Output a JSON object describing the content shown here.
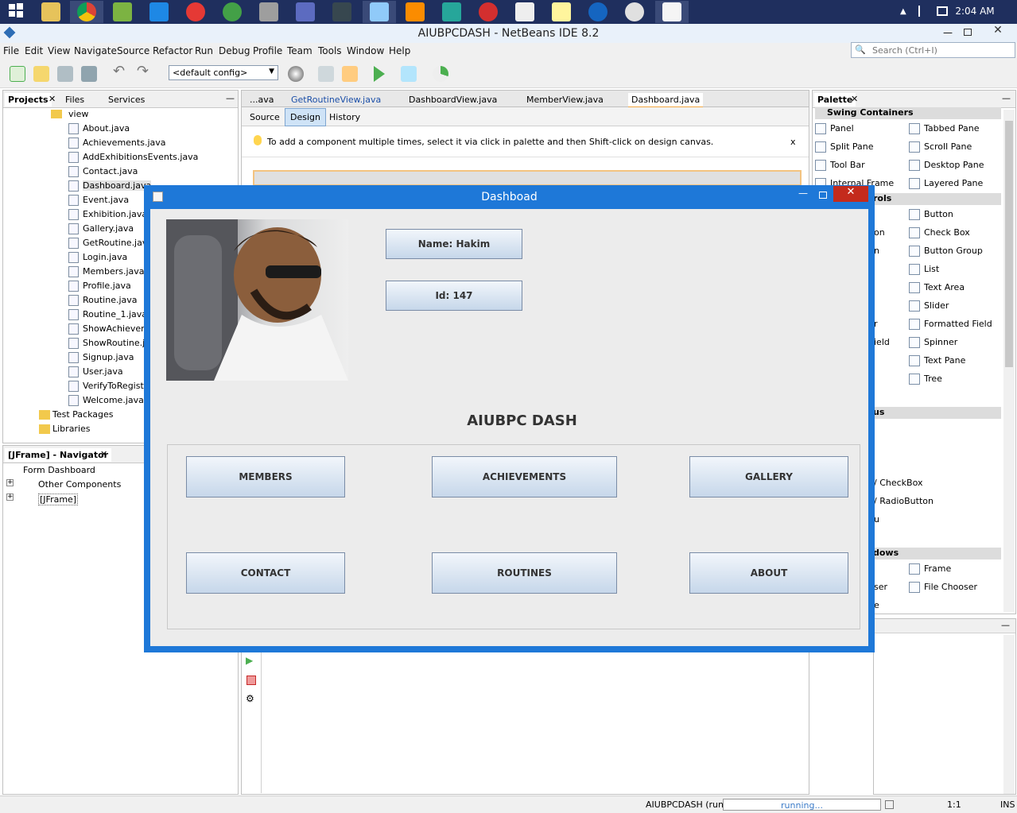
{
  "taskbar": {
    "clock": "2:04 AM"
  },
  "window": {
    "title": "AIUBPCDASH - NetBeans IDE 8.2"
  },
  "menu": [
    "File",
    "Edit",
    "View",
    "Navigate",
    "Source",
    "Refactor",
    "Run",
    "Debug",
    "Profile",
    "Team",
    "Tools",
    "Window",
    "Help"
  ],
  "toolbar": {
    "config": "<default config>"
  },
  "search": {
    "placeholder": "Search (Ctrl+I)"
  },
  "projects_panel": {
    "tabs": [
      "Projects",
      "Files",
      "Services"
    ],
    "folder": "view",
    "files": [
      "About.java",
      "Achievements.java",
      "AddExhibitionsEvents.java",
      "Contact.java",
      "Dashboard.java",
      "Event.java",
      "Exhibition.java",
      "Gallery.java",
      "GetRoutine.java",
      "Login.java",
      "Members.java",
      "Profile.java",
      "Routine.java",
      "Routine_1.java",
      "ShowAchieveme",
      "ShowRoutine.ja",
      "Signup.java",
      "User.java",
      "VerifyToRegiste",
      "Welcome.java"
    ],
    "extra": [
      "Test Packages",
      "Libraries"
    ]
  },
  "navigator": {
    "title": "[JFrame] - Navigator",
    "items": [
      "Form Dashboard",
      "Other Components",
      "[JFrame]"
    ]
  },
  "editor": {
    "tabs": [
      "...ava",
      "GetRoutineView.java",
      "DashboardView.java",
      "MemberView.java",
      "Dashboard.java"
    ],
    "modes": [
      "Source",
      "Design",
      "History"
    ],
    "hint": "To add a component multiple times, select it via click in palette and then Shift-click on design canvas.",
    "hint_close": "x"
  },
  "palette": {
    "title": "Palette",
    "sections": [
      "Swing Containers",
      "rols",
      "us",
      "dows"
    ],
    "left_items": [
      "Panel",
      "Split Pane",
      "Tool Bar",
      "Internal Frame"
    ],
    "right_items": [
      "Tabbed Pane",
      "Scroll Pane",
      "Desktop Pane",
      "Layered Pane"
    ],
    "controls_right": [
      "Button",
      "Check Box",
      "Button Group",
      "List",
      "Text Area",
      "Slider",
      "Formatted Field",
      "Spinner",
      "Text Pane",
      "Tree"
    ],
    "controls_left_fragments": [
      "on",
      "n",
      "r",
      "ield"
    ],
    "menu_fragments": [
      "/ CheckBox",
      "/ RadioButton",
      "u"
    ],
    "windows_right": [
      "Frame",
      "File Chooser"
    ],
    "windows_left_fragments": [
      "ser",
      "e"
    ]
  },
  "dialog": {
    "title": "Dashboad",
    "name": "Name: Hakim",
    "id": "Id: 147",
    "heading": "AIUBPC DASH",
    "buttons": [
      "MEMBERS",
      "ACHIEVEMENTS",
      "GALLERY",
      "CONTACT",
      "ROUTINES",
      "ABOUT"
    ]
  },
  "status": {
    "project": "AIUBPCDASH (run)",
    "progress_text": "running...",
    "position": "1:1",
    "mode": "INS"
  }
}
